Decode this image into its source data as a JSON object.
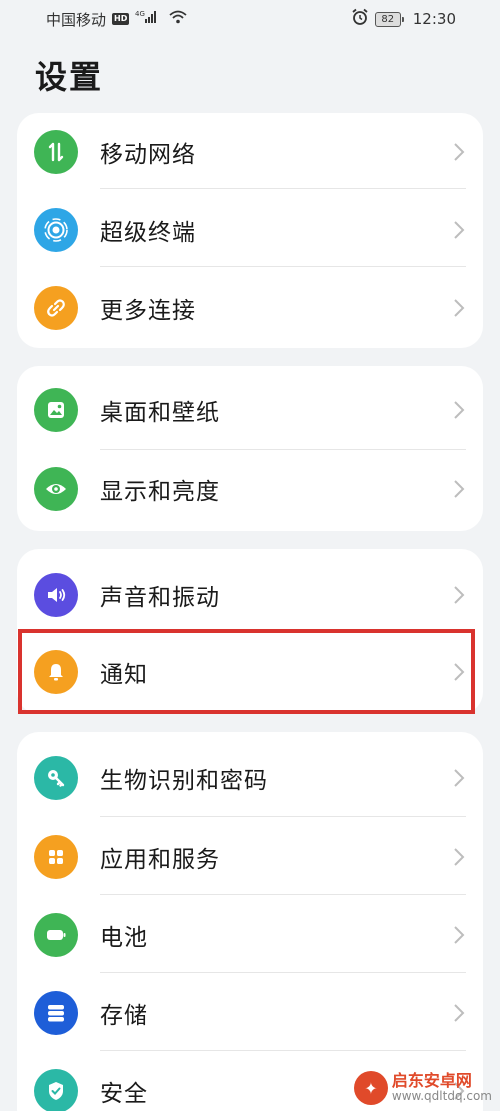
{
  "status_bar": {
    "carrier": "中国移动",
    "hd": "HD",
    "network": "4G",
    "battery": "82",
    "time": "12:30"
  },
  "page": {
    "title": "设置"
  },
  "groups": [
    {
      "items": [
        {
          "label": "移动网络",
          "icon": "mobile-data-icon",
          "color": "#3fb555"
        },
        {
          "label": "超级终端",
          "icon": "super-device-icon",
          "color": "#2ea6e6"
        },
        {
          "label": "更多连接",
          "icon": "link-icon",
          "color": "#f5a020"
        }
      ]
    },
    {
      "items": [
        {
          "label": "桌面和壁纸",
          "icon": "wallpaper-icon",
          "color": "#3fb555"
        },
        {
          "label": "显示和亮度",
          "icon": "eye-icon",
          "color": "#3fb555"
        }
      ]
    },
    {
      "items": [
        {
          "label": "声音和振动",
          "icon": "speaker-icon",
          "color": "#5b4de0"
        },
        {
          "label": "通知",
          "icon": "bell-icon",
          "color": "#f5a020"
        }
      ]
    },
    {
      "items": [
        {
          "label": "生物识别和密码",
          "icon": "key-icon",
          "color": "#2bb8a6"
        },
        {
          "label": "应用和服务",
          "icon": "apps-icon",
          "color": "#f5a020"
        },
        {
          "label": "电池",
          "icon": "battery-icon",
          "color": "#3fb555"
        },
        {
          "label": "存储",
          "icon": "storage-icon",
          "color": "#1e5ed8"
        },
        {
          "label": "安全",
          "icon": "shield-icon",
          "color": "#2bb8a6"
        }
      ]
    }
  ],
  "watermark": {
    "name": "启东安卓网",
    "url": "www.qdltdq.com"
  }
}
